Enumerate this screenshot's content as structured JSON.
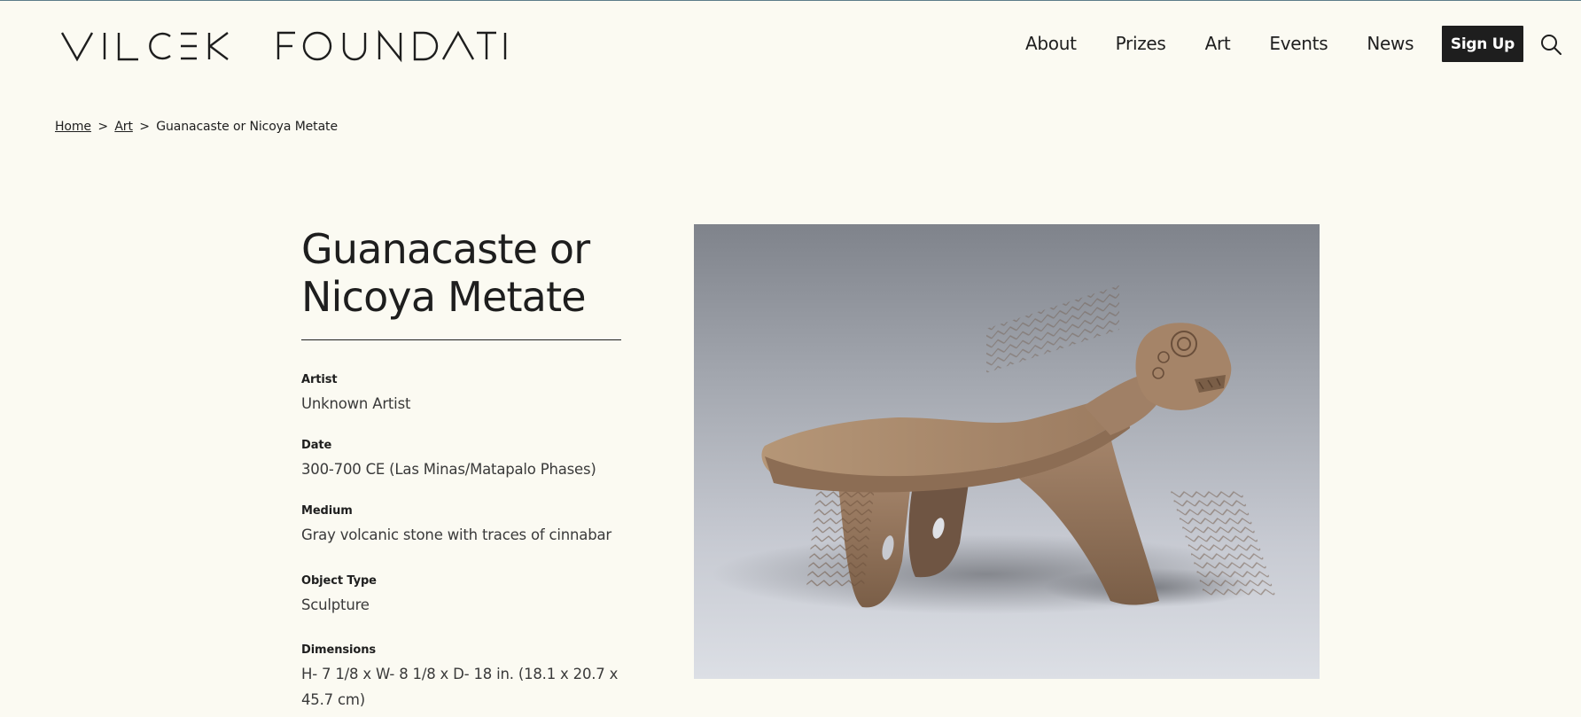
{
  "header": {
    "logo_text": "VILCEK FOUNDATION",
    "nav": [
      "About",
      "Prizes",
      "Art",
      "Events",
      "News"
    ],
    "signup_label": "Sign Up"
  },
  "breadcrumb": {
    "home": "Home",
    "sep": ">",
    "art": "Art",
    "current": "Guanacaste or Nicoya Metate"
  },
  "artwork": {
    "title_line1": "Guanacaste or",
    "title_line2": "Nicoya Metate",
    "details": [
      {
        "label": "Artist",
        "value": "Unknown Artist"
      },
      {
        "label": "Date",
        "value": "300-700 CE (Las Minas/Matapalo Phases)"
      },
      {
        "label": "Medium",
        "value": "Gray volcanic stone with traces of cinnabar"
      },
      {
        "label": "Object Type",
        "value": "Sculpture"
      },
      {
        "label": "Dimensions",
        "value": "H- 7 1/8 x W- 8 1/8 x D- 18 in. (18.1 x 20.7 x 45.7 cm)"
      }
    ]
  }
}
